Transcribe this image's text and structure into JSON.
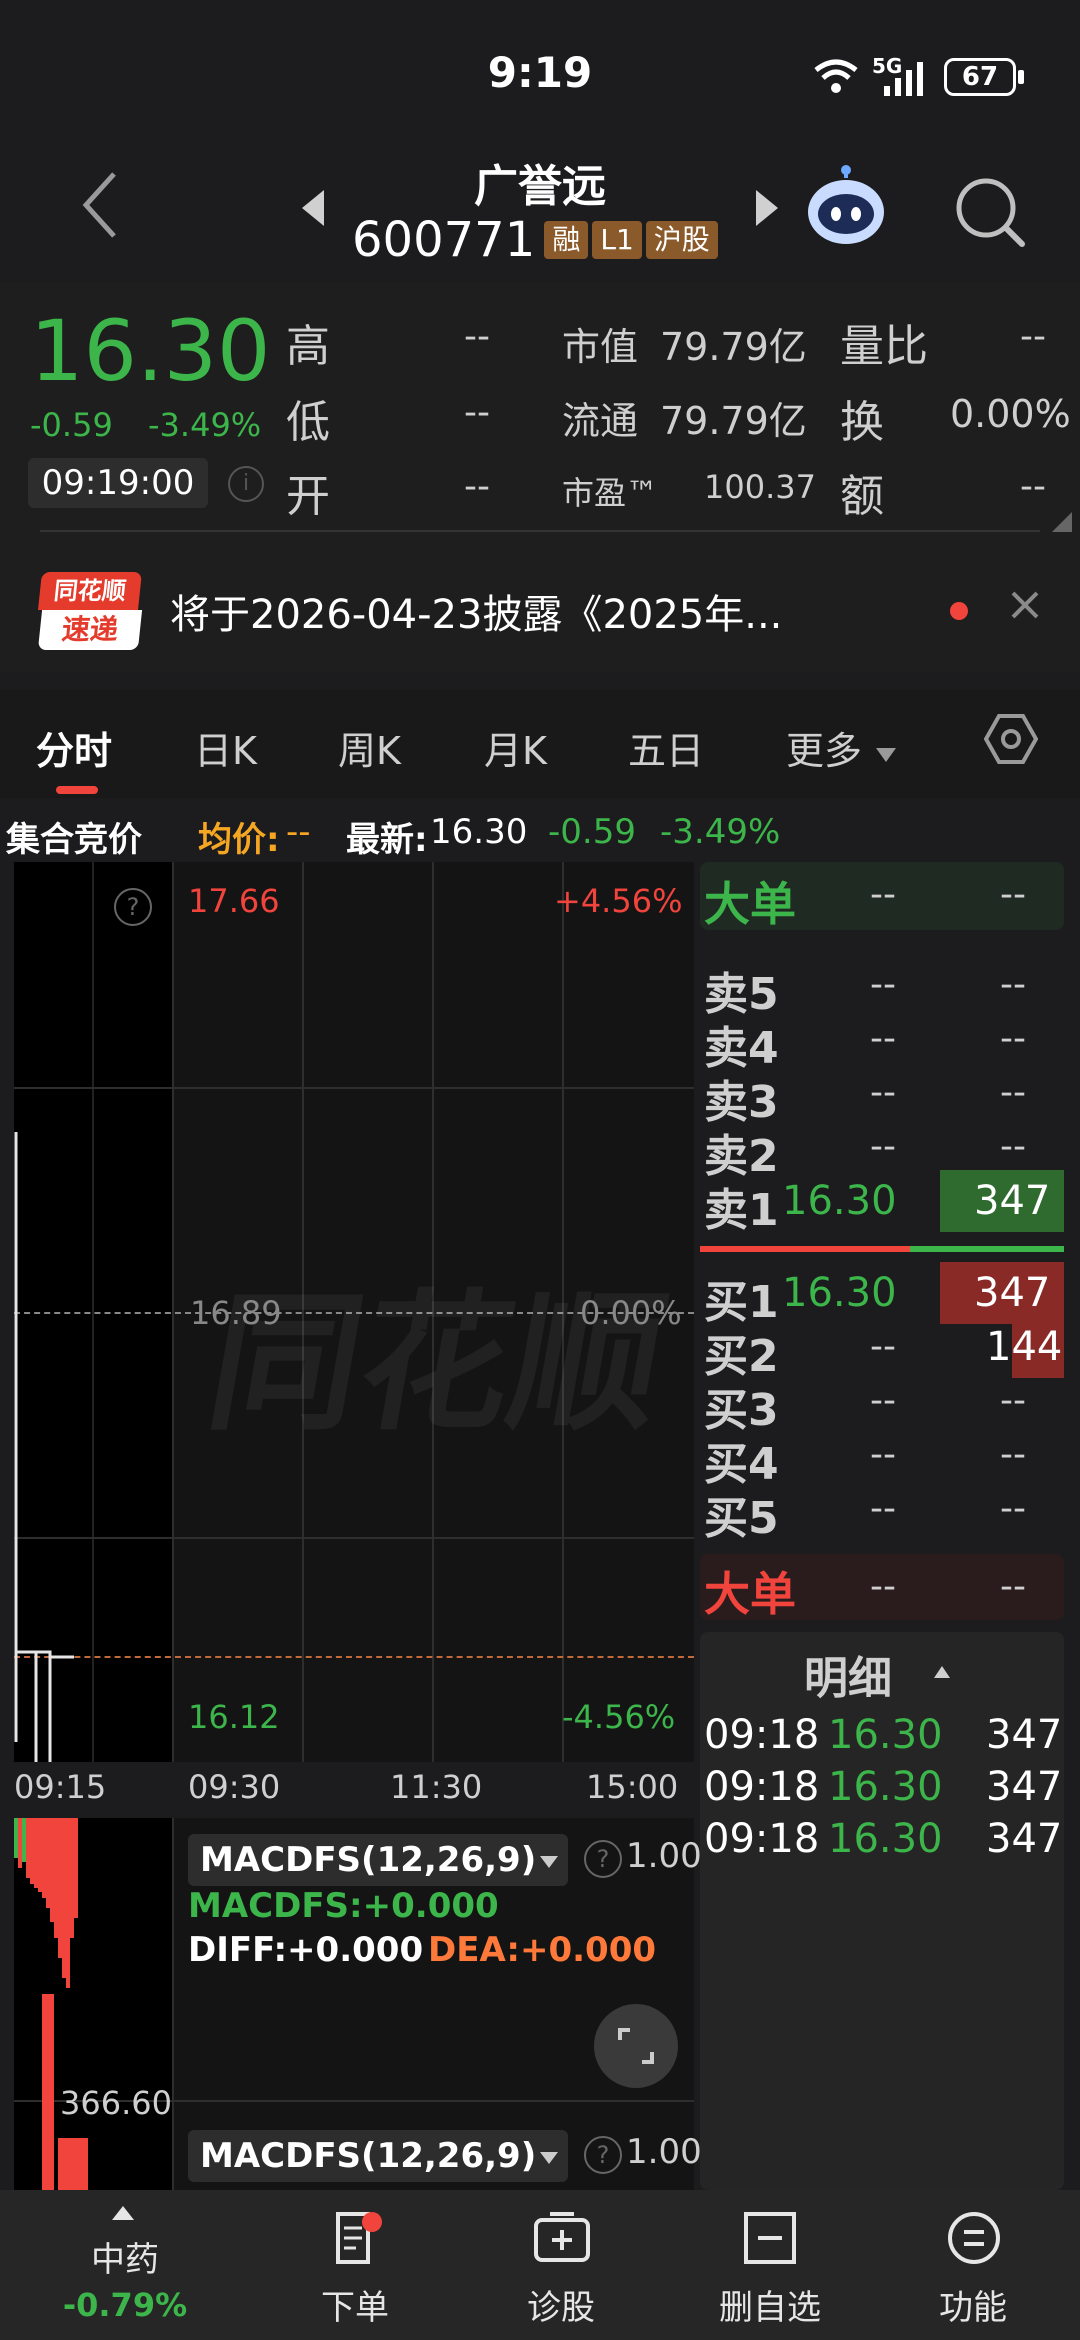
{
  "status": {
    "time": "9:19",
    "network": "5G",
    "battery": "67"
  },
  "header": {
    "name": "广誉远",
    "code": "600771",
    "tags": [
      "融",
      "L1",
      "沪股"
    ]
  },
  "quote": {
    "price": "16.30",
    "change": "-0.59",
    "change_pct": "-3.49%",
    "time": "09:19:00",
    "high_label": "高",
    "high_value": "--",
    "low_label": "低",
    "low_value": "--",
    "open_label": "开",
    "open_value": "--",
    "mktcap_label": "市值",
    "mktcap_value": "79.79亿",
    "float_label": "流通",
    "float_value": "79.79亿",
    "pe_label": "市盈™",
    "pe_value": "100.37",
    "vol_ratio_label": "量比",
    "vol_ratio_value": "--",
    "turnover_label": "换",
    "turnover_value": "0.00%",
    "amount_label": "额",
    "amount_value": "--"
  },
  "news": {
    "logo_top": "同花顺",
    "logo_bottom": "速递",
    "text": "将于2026-04-23披露《2025年..."
  },
  "tabs": {
    "items": [
      "分时",
      "日K",
      "周K",
      "月K",
      "五日",
      "更多"
    ],
    "active": 0
  },
  "info_line": {
    "label": "集合竞价",
    "avg_label": "均价:",
    "avg_value": "--",
    "latest_label": "最新:",
    "latest_value": "16.30",
    "change": "-0.59",
    "change_pct": "-3.49%"
  },
  "chart": {
    "max_price": "17.66",
    "max_pct": "+4.56%",
    "mid_price": "16.89",
    "mid_pct": "0.00%",
    "min_price": "16.12",
    "min_pct": "-4.56%",
    "times": [
      "09:15",
      "09:30",
      "11:30",
      "15:00"
    ],
    "watermark": "同花顺"
  },
  "macd": {
    "selector": "MACDFS(12,26,9)",
    "scale_value": "1.00",
    "macd_line": "MACDFS:+0.000",
    "diff_line": "DIFF:+0.000",
    "dea_line": "DEA:+0.000",
    "volume_label": "366.60",
    "selector2": "MACDFS(12,26,9)",
    "scale_value2": "1.00"
  },
  "orderbook": {
    "big_top_label": "大单",
    "big_top_v1": "--",
    "big_top_v2": "--",
    "sells": [
      {
        "label": "卖5",
        "price": "--",
        "vol": "--"
      },
      {
        "label": "卖4",
        "price": "--",
        "vol": "--"
      },
      {
        "label": "卖3",
        "price": "--",
        "vol": "--"
      },
      {
        "label": "卖2",
        "price": "--",
        "vol": "--"
      },
      {
        "label": "卖1",
        "price": "16.30",
        "vol": "347"
      }
    ],
    "buys": [
      {
        "label": "买1",
        "price": "16.30",
        "vol": "347"
      },
      {
        "label": "买2",
        "price": "--",
        "vol": "144"
      },
      {
        "label": "买3",
        "price": "--",
        "vol": "--"
      },
      {
        "label": "买4",
        "price": "--",
        "vol": "--"
      },
      {
        "label": "买5",
        "price": "--",
        "vol": "--"
      }
    ],
    "big_bottom_label": "大单",
    "big_bottom_v1": "--",
    "big_bottom_v2": "--",
    "detail_title": "明细",
    "details": [
      {
        "time": "09:18",
        "price": "16.30",
        "vol": "347"
      },
      {
        "time": "09:18",
        "price": "16.30",
        "vol": "347"
      },
      {
        "time": "09:18",
        "price": "16.30",
        "vol": "347"
      }
    ]
  },
  "bottom": {
    "sector_name": "中药",
    "sector_change": "-0.79%",
    "items": [
      "下单",
      "诊股",
      "删自选",
      "功能"
    ]
  },
  "colors": {
    "up": "#f0443c",
    "down": "#3cb54a",
    "accent": "#f5a623"
  }
}
